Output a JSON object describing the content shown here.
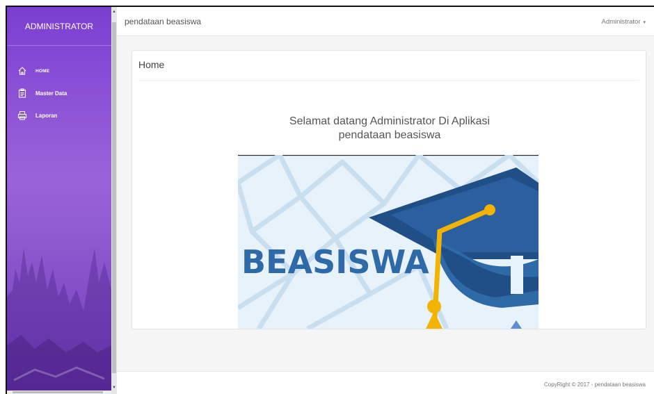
{
  "sidebar": {
    "brand": "ADMINISTRATOR",
    "items": [
      {
        "label": "HOME",
        "icon": "home-icon"
      },
      {
        "label": "Master Data",
        "icon": "clipboard-icon"
      },
      {
        "label": "Laporan",
        "icon": "printer-icon"
      }
    ]
  },
  "header": {
    "app_title": "pendataan beasiswa",
    "user": "Administrator"
  },
  "panel": {
    "title": "Home",
    "welcome_line1": "Selamat datang Administrator Di Aplikasi",
    "welcome_line2": "pendataan beasiswa",
    "hero_text": "BEASISWA"
  },
  "footer": {
    "copyright": "CopyRight © 2017 - pendataan beasiswa"
  },
  "colors": {
    "sidebar": "#8a4fd6",
    "hero_text": "#2e6aa8",
    "cap": "#1f4f86",
    "tassel": "#f2b400"
  }
}
